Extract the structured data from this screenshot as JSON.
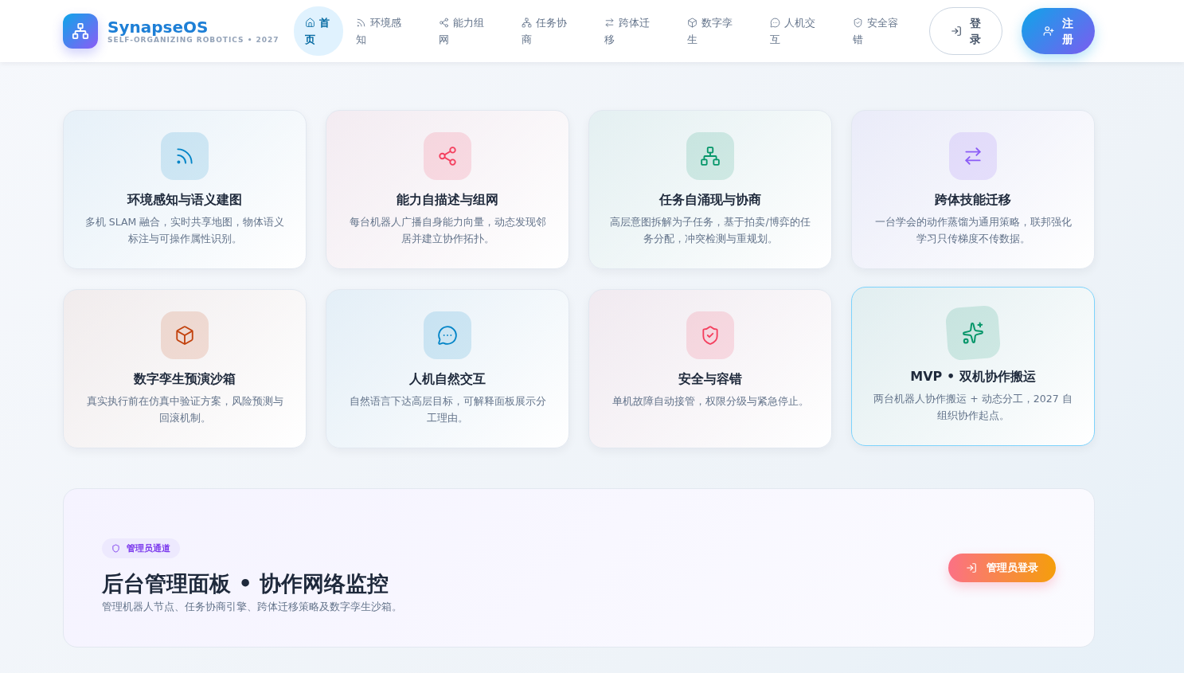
{
  "brand": {
    "name": "SynapseOS",
    "tagline": "SELF-ORGANIZING ROBOTICS • 2027"
  },
  "nav": [
    {
      "label": "首页",
      "kind": "home",
      "selected": true
    },
    {
      "label": "环境感知",
      "kind": "signal",
      "selected": false
    },
    {
      "label": "能力组网",
      "kind": "share",
      "selected": false
    },
    {
      "label": "任务协商",
      "kind": "network",
      "selected": false
    },
    {
      "label": "跨体迁移",
      "kind": "arrows",
      "selected": false
    },
    {
      "label": "数字孪生",
      "kind": "box",
      "selected": false
    },
    {
      "label": "人机交互",
      "kind": "chat",
      "selected": false
    },
    {
      "label": "安全容错",
      "kind": "shield",
      "selected": false
    }
  ],
  "auth": {
    "login": "登录",
    "register": "注册"
  },
  "features": [
    {
      "title": "环境感知与语义建图",
      "description": "多机 SLAM 融合，实时共享地图，物体语义标注与可操作属性识别。",
      "kind": "signal",
      "color": "#0284c7",
      "highlighted": false
    },
    {
      "title": "能力自描述与组网",
      "description": "每台机器人广播自身能力向量，动态发现邻居并建立协作拓扑。",
      "kind": "share",
      "color": "#f43f5e",
      "highlighted": false
    },
    {
      "title": "任务自涌现与协商",
      "description": "高层意图拆解为子任务，基于拍卖/博弈的任务分配，冲突检测与重规划。",
      "kind": "network",
      "color": "#059669",
      "highlighted": false
    },
    {
      "title": "跨体技能迁移",
      "description": "一台学会的动作蒸馏为通用策略，联邦强化学习只传梯度不传数据。",
      "kind": "arrows",
      "color": "#8b5cf6",
      "highlighted": false
    },
    {
      "title": "数字孪生预演沙箱",
      "description": "真实执行前在仿真中验证方案，风险预测与回滚机制。",
      "kind": "box",
      "color": "#c2410c",
      "highlighted": false
    },
    {
      "title": "人机自然交互",
      "description": "自然语言下达高层目标，可解释面板展示分工理由。",
      "kind": "chat",
      "color": "#0284c7",
      "highlighted": false
    },
    {
      "title": "安全与容错",
      "description": "单机故障自动接管，权限分级与紧急停止。",
      "kind": "shield",
      "color": "#f43f5e",
      "highlighted": false
    },
    {
      "title": "MVP • 双机协作搬运",
      "description": "两台机器人协作搬运 + 动态分工，2027 自组织协作起点。",
      "kind": "sparkles",
      "color": "#059669",
      "highlighted": true
    }
  ],
  "admin": {
    "badge": "管理员通道",
    "title": "后台管理面板 • 协作网络监控",
    "description": "管理机器人节点、任务协商引擎、跨体迁移策略及数字孪生沙箱。",
    "button": "管理员登录"
  }
}
